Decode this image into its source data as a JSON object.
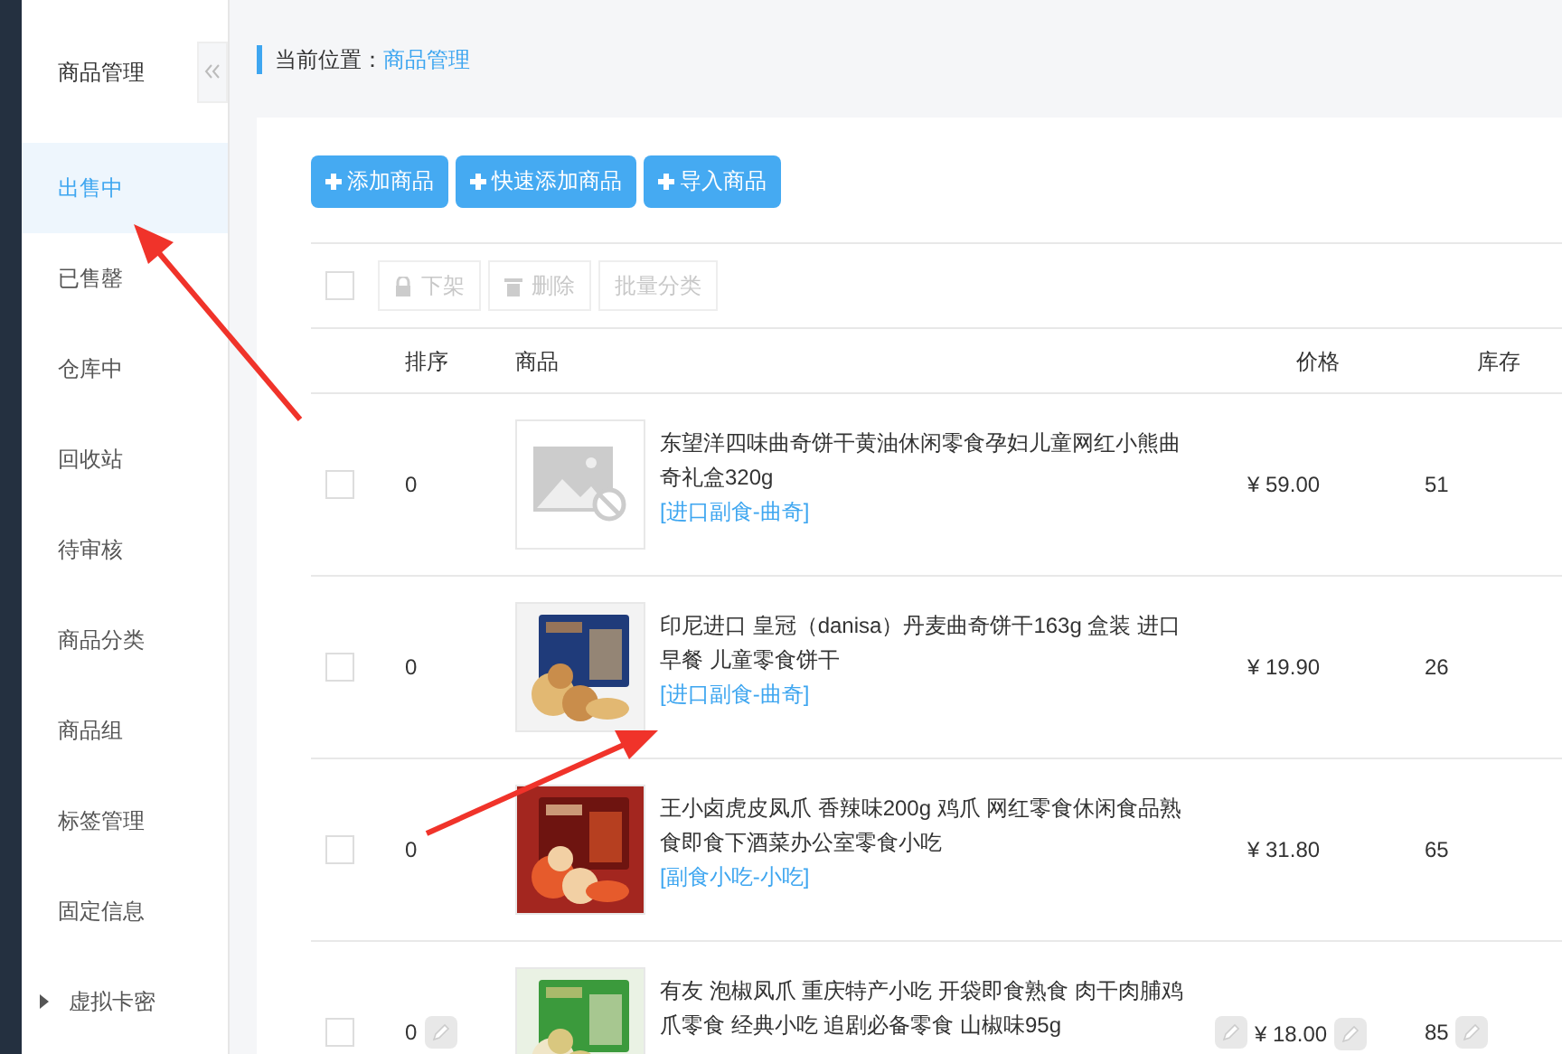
{
  "sidebar": {
    "title": "商品管理",
    "items": [
      {
        "label": "出售中",
        "selected": true,
        "kind": "link"
      },
      {
        "label": "已售罄",
        "selected": false,
        "kind": "link"
      },
      {
        "label": "仓库中",
        "selected": false,
        "kind": "link"
      },
      {
        "label": "回收站",
        "selected": false,
        "kind": "link"
      },
      {
        "label": "待审核",
        "selected": false,
        "kind": "link"
      },
      {
        "label": "商品分类",
        "selected": false,
        "kind": "link"
      },
      {
        "label": "商品组",
        "selected": false,
        "kind": "link"
      },
      {
        "label": "标签管理",
        "selected": false,
        "kind": "link"
      },
      {
        "label": "固定信息",
        "selected": false,
        "kind": "link"
      },
      {
        "label": "虚拟卡密",
        "selected": false,
        "kind": "group",
        "expanded": false
      }
    ]
  },
  "breadcrumb": {
    "label": "当前位置：",
    "current": "商品管理"
  },
  "buttons": [
    "添加商品",
    "快速添加商品",
    "导入商品"
  ],
  "toolbar": {
    "select_all": {
      "checked": false
    },
    "actions": [
      {
        "label": "下架",
        "kind": "lock",
        "disabled": true
      },
      {
        "label": "删除",
        "kind": "trash",
        "disabled": true
      },
      {
        "label": "批量分类",
        "kind": "text",
        "disabled": true
      }
    ]
  },
  "table": {
    "columns": [
      "排序",
      "商品",
      "价格",
      "库存"
    ],
    "rows": [
      {
        "checked": false,
        "sort": "0",
        "title": "东望洋四味曲奇饼干黄油休闲零食孕妇儿童网红小熊曲奇礼盒320g",
        "category": "[进口副食-曲奇]",
        "price": "¥ 59.00",
        "stock": "51",
        "kind": "placeholder",
        "editable": false
      },
      {
        "checked": false,
        "sort": "0",
        "title": "印尼进口 皇冠（danisa）丹麦曲奇饼干163g 盒装 进口早餐 儿童零食饼干",
        "category": "[进口副食-曲奇]",
        "price": "¥ 19.90",
        "stock": "26",
        "kind": "picture",
        "editable": false
      },
      {
        "checked": false,
        "sort": "0",
        "title": "王小卤虎皮凤爪 香辣味200g 鸡爪 网红零食休闲食品熟食即食下酒菜办公室零食小吃",
        "category": "[副食小吃-小吃]",
        "price": "¥ 31.80",
        "stock": "65",
        "kind": "picture",
        "editable": false
      },
      {
        "checked": false,
        "sort": "0",
        "title": "有友 泡椒凤爪 重庆特产小吃 开袋即食熟食 肉干肉脯鸡爪零食 经典小吃 追剧必备零食 山椒味95g",
        "price": "¥ 18.00",
        "stock": "85",
        "kind": "picture",
        "editable": true
      }
    ]
  }
}
